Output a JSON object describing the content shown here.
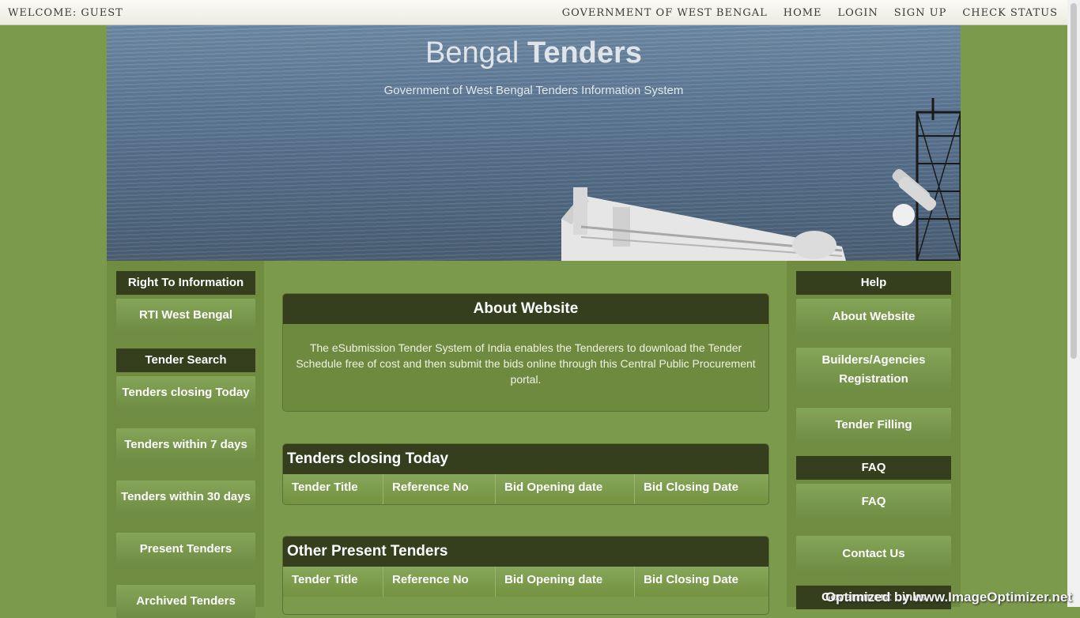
{
  "topbar": {
    "welcome": "WELCOME: GUEST",
    "links": [
      "GOVERNMENT OF WEST BENGAL",
      "HOME",
      "LOGIN",
      "SIGN UP",
      "CHECK STATUS"
    ]
  },
  "hero": {
    "title_part1": "Bengal ",
    "title_part2": "Tenders",
    "subtitle": "Government of West Bengal Tenders Information System"
  },
  "left": {
    "rti_heading": "Right To Information",
    "rti_link": "RTI West Bengal",
    "search_heading": "Tender Search",
    "search_links": [
      "Tenders closing Today",
      "Tenders within 7 days",
      "Tenders within 30 days",
      "Present Tenders",
      "Archived Tenders"
    ]
  },
  "main": {
    "about_title": "About Website",
    "about_text": "The eSubmission Tender System of India enables the Tenderers to download the Tender Schedule free of cost and then submit the bids online through this Central Public Procurement portal.",
    "closing_title": "Tenders closing Today",
    "other_title": "Other Present Tenders",
    "columns": [
      "Tender Title",
      "Reference No",
      "Bid Opening date",
      "Bid Closing Date"
    ]
  },
  "right": {
    "help_heading": "Help",
    "about_link": "About Website",
    "builders_link": "Builders/Agencies Registration",
    "filling_link": "Tender Filling",
    "faq_heading": "FAQ",
    "faq_link": "FAQ",
    "contact_link": "Contact Us",
    "gov_heading": "Government Links"
  },
  "watermark": "Optimized by www.ImageOptimizer.net",
  "colors": {
    "background": "#7b9a4c",
    "heading": "#353f1d",
    "button": "#7a9a4d",
    "topbar": "#f4f4ec"
  }
}
